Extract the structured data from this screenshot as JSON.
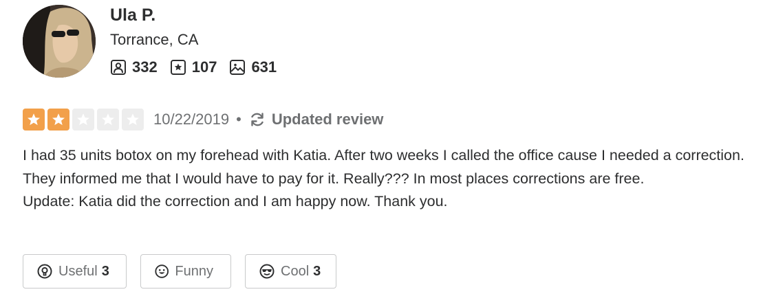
{
  "user": {
    "name": "Ula P.",
    "location": "Torrance, CA",
    "stats": {
      "friends": "332",
      "reviews": "107",
      "photos": "631"
    }
  },
  "review": {
    "rating": 2,
    "max_rating": 5,
    "date": "10/22/2019",
    "separator": "•",
    "updated_label": "Updated review",
    "text_paragraph_1": "I had 35 units botox on my forehead with Katia. After two weeks I called the office cause I needed a correction. They informed me that I would have to pay for it. Really???  In most places corrections are free.",
    "text_paragraph_2": "Update: Katia did the correction and I am happy now. Thank you."
  },
  "actions": {
    "useful_label": "Useful",
    "useful_count": "3",
    "funny_label": "Funny",
    "funny_count": "",
    "cool_label": "Cool",
    "cool_count": "3"
  },
  "colors": {
    "star_on": "#f2a04a",
    "star_off": "#ededed",
    "text": "#2d2e2f",
    "muted": "#6e7072"
  }
}
